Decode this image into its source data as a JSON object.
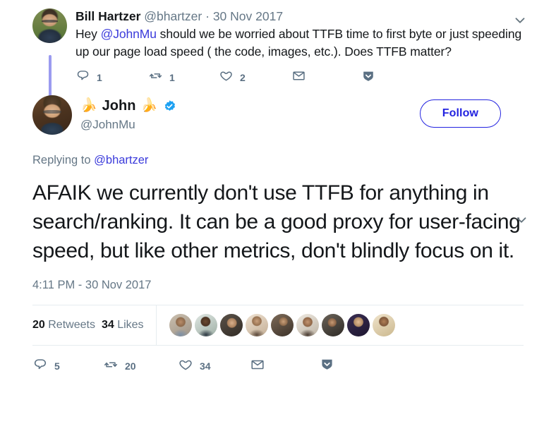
{
  "ancestor_tweet": {
    "author_name": "Bill Hartzer",
    "author_handle": "@bhartzer",
    "separator": "·",
    "date": "30 Nov 2017",
    "text_before_mention": "Hey ",
    "mention": "@JohnMu",
    "text_after_mention": " should we be worried about TTFB time to first byte or just speeding up our page load speed ( the code, images, etc.). Does TTFB matter?",
    "avatar_name": "bill-hartzer-avatar",
    "actions": [
      {
        "icon": "reply-icon",
        "count": "1"
      },
      {
        "icon": "retweet-icon",
        "count": "1"
      },
      {
        "icon": "like-heart-icon",
        "count": "2"
      },
      {
        "icon": "direct-message-envelope-icon",
        "count": ""
      },
      {
        "icon": "share-chevron-badge-icon",
        "count": ""
      }
    ],
    "caret_icon": "chevron-down-icon"
  },
  "main_tweet": {
    "author_emoji_left": "🍌",
    "author_name": "John",
    "author_emoji_right": "🍌",
    "verified_icon": "verified-badge-icon",
    "author_handle": "@JohnMu",
    "follow_label": "Follow",
    "caret_icon": "chevron-down-icon",
    "replying_prefix": "Replying to ",
    "replying_handle": "@bhartzer",
    "text": "AFAIK we currently don't use TTFB for anything in search/ranking. It can be a good proxy for user-facing speed, but like other metrics, don't blindly focus on it.",
    "timestamp": "4:11 PM - 30 Nov 2017",
    "retweets_count": "20",
    "retweets_label": "Retweets",
    "likes_count": "34",
    "likes_label": "Likes",
    "facepile_count": 9,
    "actions": [
      {
        "icon": "reply-icon",
        "count": "5"
      },
      {
        "icon": "retweet-icon",
        "count": "20"
      },
      {
        "icon": "like-heart-icon",
        "count": "34"
      },
      {
        "icon": "direct-message-envelope-icon",
        "count": ""
      },
      {
        "icon": "share-chevron-badge-icon",
        "count": ""
      }
    ]
  },
  "colors": {
    "link_blue": "#3b3bdb",
    "follow_blue": "#2323e0",
    "verified_blue": "#1da1f2",
    "muted_gray": "#657786",
    "action_gray": "#5b7083",
    "thread_line": "#9b9bf0",
    "divider": "#e6ecf0",
    "text": "#14171a"
  }
}
